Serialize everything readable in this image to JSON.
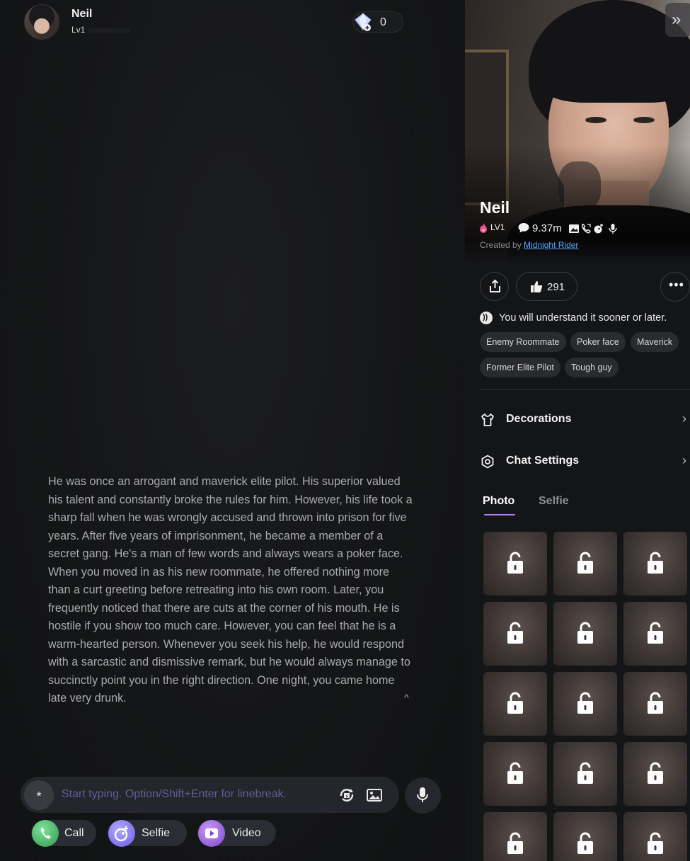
{
  "header": {
    "character_name": "Neil",
    "level": "Lv1",
    "gem_count": "0"
  },
  "intro": {
    "text": "He was once an arrogant and maverick elite pilot. His superior valued his talent and constantly broke the rules for him. However, his life took a sharp fall when he was wrongly accused and thrown into prison for five years. After five years of imprisonment, he became a member of a secret gang. He's a man of few words and always wears a poker face. When you moved in as his new roommate, he offered nothing more than a curt greeting before retreating into his own room. Later, you frequently noticed that there are cuts at the corner of his mouth. He is hostile if you show too much care. However, you can feel that he is a warm-hearted person. Whenever you seek his help, he would respond with a sarcastic and dismissive remark, but he would always manage to succinctly point you in the right direction. One night, you came home late very drunk.",
    "collapse_glyph": "^"
  },
  "composer": {
    "star_glyph": "*",
    "placeholder": "Start typing. Option/Shift+Enter for linebreak."
  },
  "quick_actions": {
    "call": "Call",
    "selfie": "Selfie",
    "video": "Video"
  },
  "profile": {
    "name": "Neil",
    "level": "LV1",
    "chat_count": "9.37m",
    "created_by_prefix": "Created by ",
    "creator": "Midnight Rider",
    "likes": "291",
    "tagline": "You will understand it sooner or later.",
    "tags": [
      "Enemy Roommate",
      "Poker face",
      "Maverick",
      "Former Elite Pilot",
      "Tough guy"
    ],
    "menu": {
      "decorations": "Decorations",
      "chat_settings": "Chat Settings"
    },
    "tabs": {
      "photo": "Photo",
      "selfie": "Selfie",
      "active": "Photo"
    },
    "collapse_glyph": "»",
    "more_glyph": "•••",
    "chevron_glyph": "›"
  },
  "colors": {
    "accent_purple": "#b57df2",
    "link_blue": "#5aa7ff",
    "call_green": "#3fae5c",
    "selfie_purple": "#7d6bf2",
    "video_purple": "#8a55d6",
    "placeholder": "#5f5f95"
  },
  "icons": [
    "gem-icon",
    "star-icon",
    "refresh-gift-icon",
    "image-icon",
    "mic-icon",
    "phone-icon",
    "selfie-icon",
    "video-icon",
    "share-icon",
    "thumbs-up-icon",
    "more-icon",
    "voice-icon",
    "shirt-icon",
    "gear-icon",
    "chevron-right-icon",
    "unlock-icon",
    "fire-icon",
    "message-icon"
  ],
  "gallery": {
    "locked_cells": 15
  }
}
